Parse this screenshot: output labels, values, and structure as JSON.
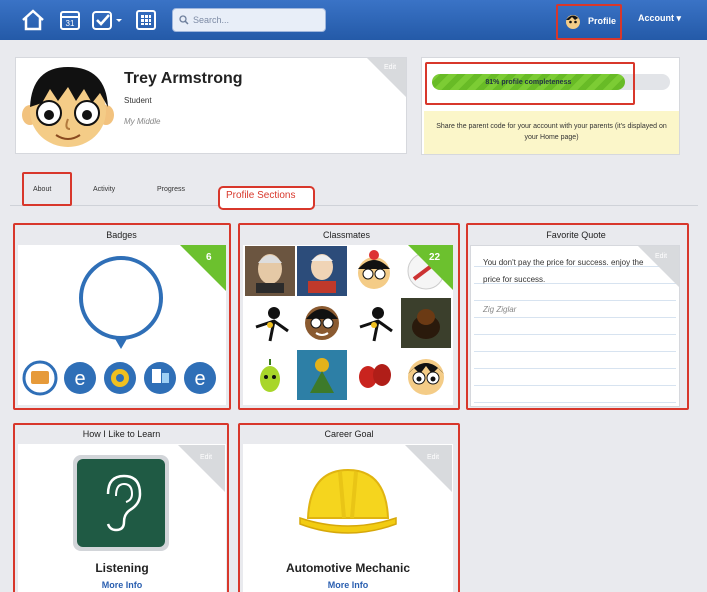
{
  "topbar": {
    "search_placeholder": "Search...",
    "calendar_day": "31",
    "profile_label": "Profile",
    "account_label": "Account ▾"
  },
  "profile": {
    "name": "Trey Armstrong",
    "role": "Student",
    "school": "My Middle",
    "edit_label": "Edit",
    "completeness_text": "81% profile completeness",
    "completeness_fraction": 0.81,
    "parent_note": "Share the parent code for your account with your parents (it's displayed on your Home page)"
  },
  "tabs": [
    {
      "label": "About"
    },
    {
      "label": "Activity"
    },
    {
      "label": "Progress"
    }
  ],
  "annotation_label": "Profile Sections",
  "badges": {
    "title": "Badges",
    "count": "6"
  },
  "classmates": {
    "title": "Classmates",
    "count": "22"
  },
  "quote": {
    "title": "Favorite Quote",
    "edit_label": "Edit",
    "text": "You don't pay the price for success. enjoy the price for success.",
    "author": "Zig Ziglar"
  },
  "learn": {
    "title": "How I Like to Learn",
    "edit_label": "Edit",
    "style": "Listening",
    "link": "More Info"
  },
  "career": {
    "title": "Career Goal",
    "edit_label": "Edit",
    "goal": "Automotive Mechanic",
    "link": "More Info"
  },
  "colors": {
    "topbar": "#2f66b8",
    "annotation_red": "#d8372b",
    "badge_green": "#6cc12e",
    "link_blue": "#2a5fb0"
  },
  "icons": [
    "home-icon",
    "calendar-icon",
    "tasks-icon",
    "grid-icon",
    "search-icon",
    "ear-icon",
    "hard-hat-icon"
  ]
}
